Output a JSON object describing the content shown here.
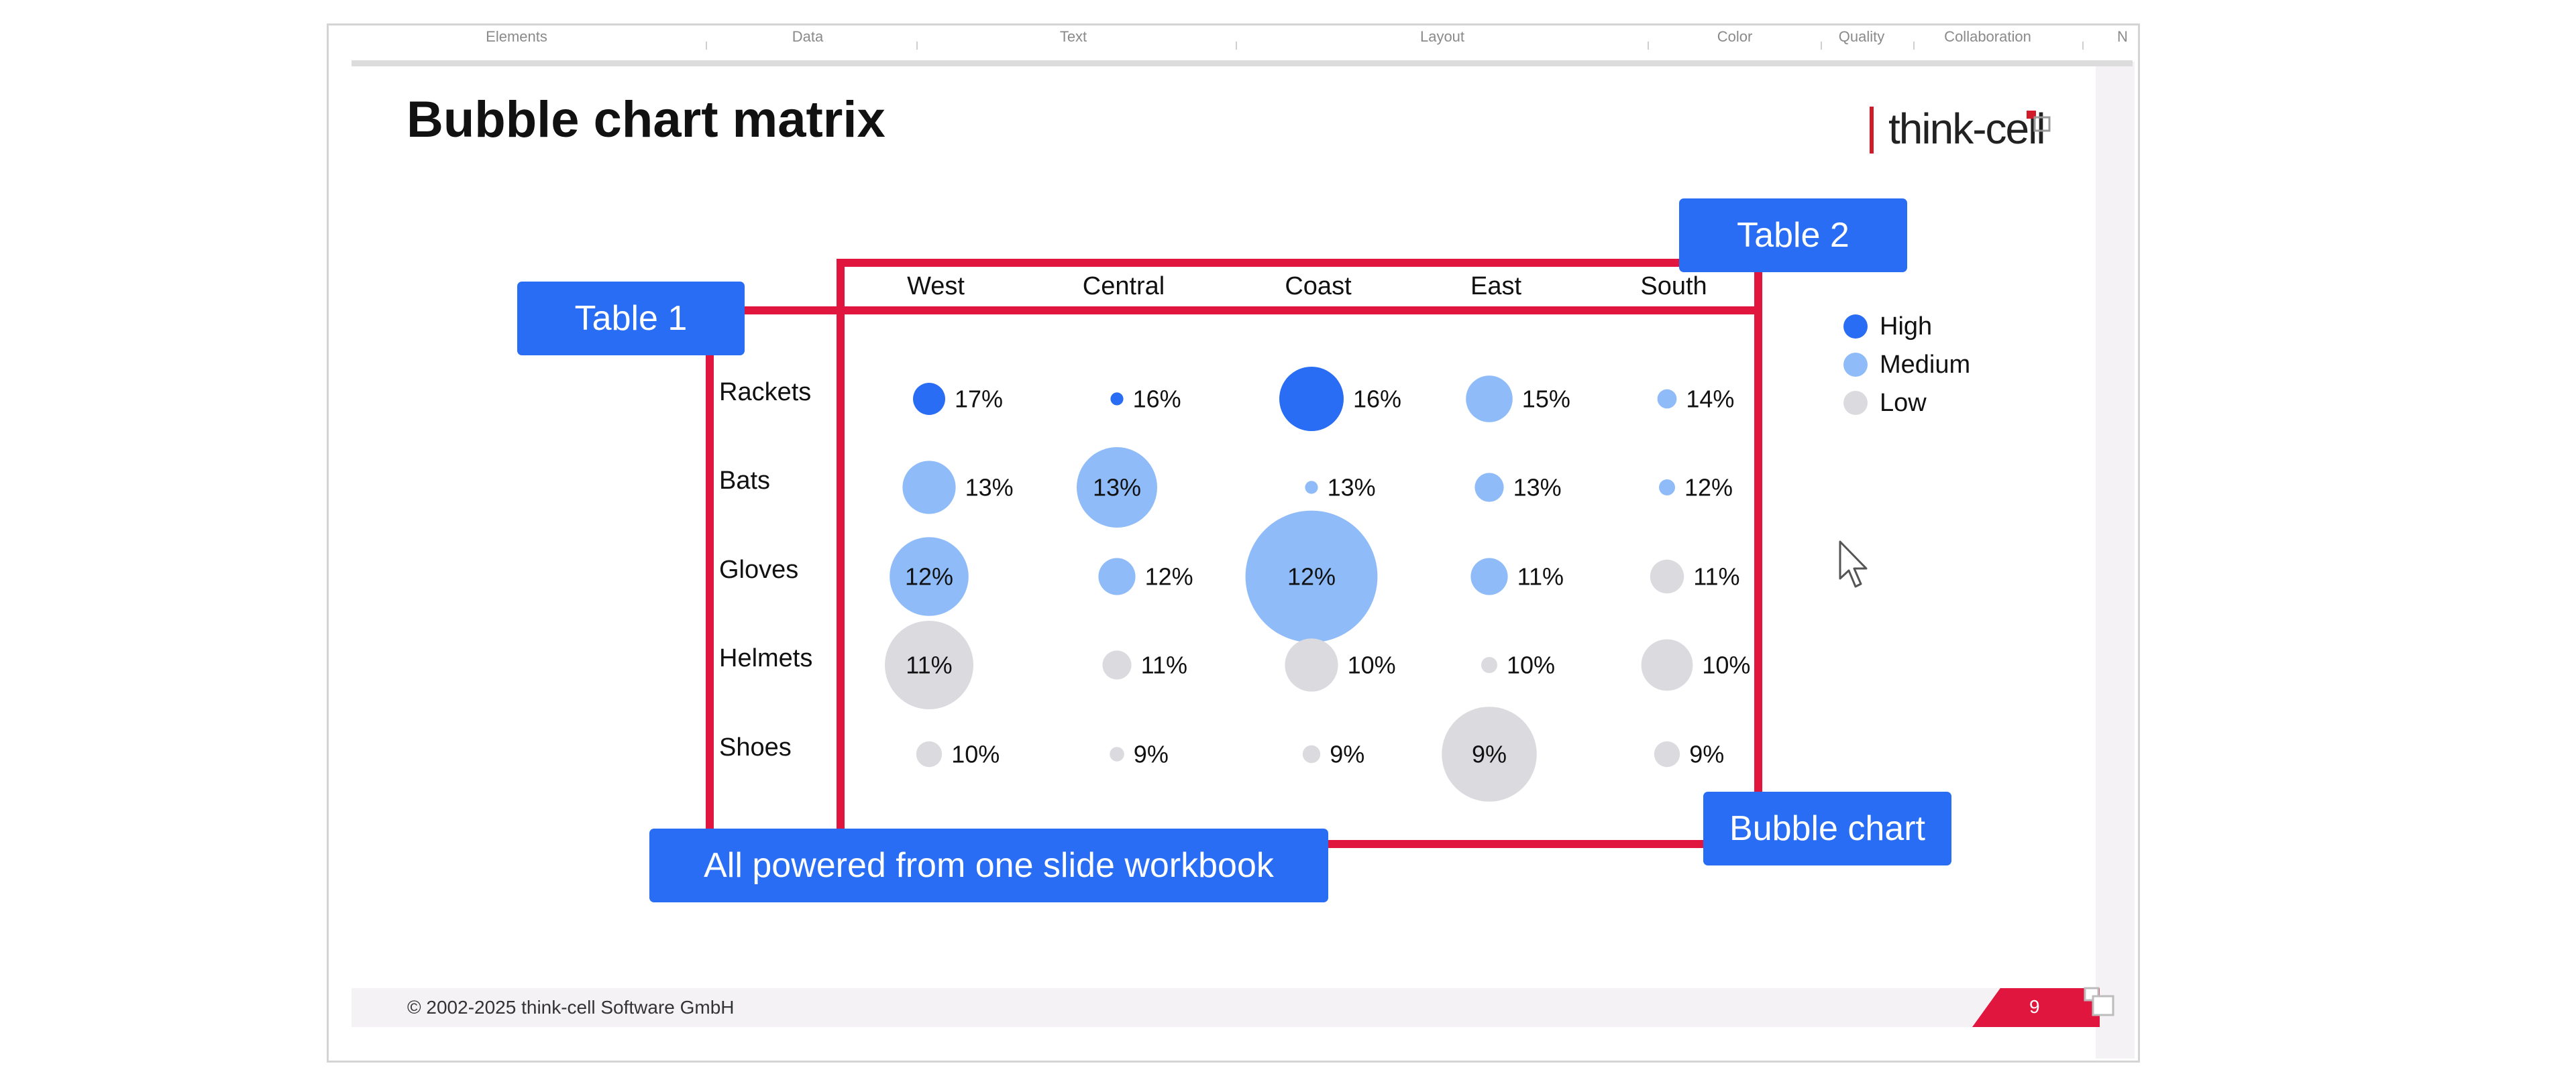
{
  "ribbon": {
    "items": [
      "Elements",
      "Data",
      "Text",
      "Layout",
      "Color",
      "Quality",
      "Collaboration",
      "N"
    ]
  },
  "slide": {
    "title": "Bubble chart matrix",
    "logo_text": "think-cell",
    "footer": "© 2002-2025 think-cell Software GmbH",
    "page_number": "9"
  },
  "callouts": {
    "table1": "Table 1",
    "table2": "Table 2",
    "bubble_chart": "Bubble chart",
    "workbook": "All powered from one slide workbook"
  },
  "colors": {
    "accent_red": "#e0163f",
    "callout_blue": "#2a6df5",
    "high": "#2a6df5",
    "medium": "#8fbcf9",
    "low": "#dbdade"
  },
  "chart_data": {
    "type": "scatter",
    "columns": [
      "West",
      "Central",
      "Coast",
      "East",
      "South"
    ],
    "rows": [
      "Rackets",
      "Bats",
      "Gloves",
      "Helmets",
      "Shoes"
    ],
    "values": [
      [
        "17%",
        "16%",
        "16%",
        "15%",
        "14%"
      ],
      [
        "13%",
        "13%",
        "13%",
        "13%",
        "12%"
      ],
      [
        "12%",
        "12%",
        "12%",
        "11%",
        "11%"
      ],
      [
        "11%",
        "11%",
        "10%",
        "10%",
        "10%"
      ],
      [
        "10%",
        "9%",
        "9%",
        "9%",
        "9%"
      ]
    ],
    "bubble_size": [
      [
        1.0,
        0.4,
        2.0,
        1.45,
        0.6
      ],
      [
        1.65,
        2.5,
        0.4,
        0.9,
        0.5
      ],
      [
        2.45,
        1.15,
        4.1,
        1.15,
        1.05
      ],
      [
        2.75,
        0.9,
        1.65,
        0.5,
        1.6
      ],
      [
        0.8,
        0.45,
        0.55,
        2.95,
        0.8
      ]
    ],
    "category": [
      [
        "High",
        "High",
        "High",
        "Medium",
        "Medium"
      ],
      [
        "Medium",
        "Medium",
        "Medium",
        "Medium",
        "Medium"
      ],
      [
        "Medium",
        "Medium",
        "Medium",
        "Medium",
        "Low"
      ],
      [
        "Low",
        "Low",
        "Low",
        "Low",
        "Low"
      ],
      [
        "Low",
        "Low",
        "Low",
        "Low",
        "Low"
      ]
    ],
    "label_inside": [
      [
        false,
        false,
        false,
        false,
        false
      ],
      [
        false,
        true,
        false,
        false,
        false
      ],
      [
        true,
        false,
        true,
        false,
        false
      ],
      [
        true,
        false,
        false,
        false,
        false
      ],
      [
        false,
        false,
        false,
        true,
        false
      ]
    ],
    "legend": [
      {
        "name": "High",
        "color": "#2a6df5"
      },
      {
        "name": "Medium",
        "color": "#8fbcf9"
      },
      {
        "name": "Low",
        "color": "#dbdade"
      }
    ],
    "legend_position": "right"
  }
}
